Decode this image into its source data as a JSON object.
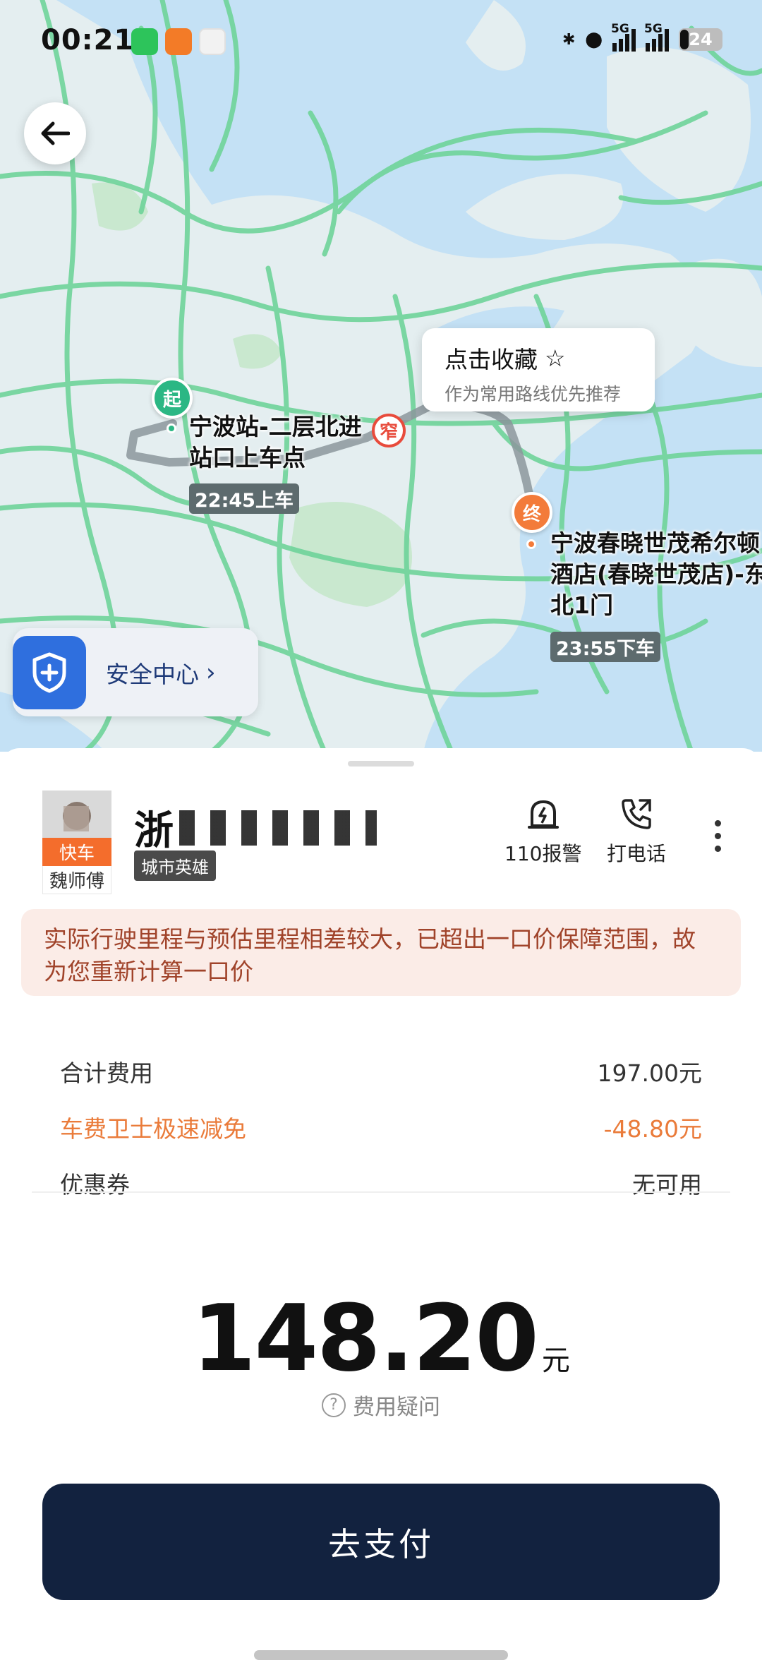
{
  "status_bar": {
    "time": "00:21",
    "battery": "24",
    "network1": "5G",
    "network2": "5G"
  },
  "map": {
    "favorite_card": {
      "title": "点击收藏",
      "subtitle": "作为常用路线优先推荐"
    },
    "start": {
      "pin": "起",
      "label_line1": "宁波站-二层北进",
      "label_line2": "站口上车点",
      "time": "22:45上车"
    },
    "end": {
      "pin": "终",
      "label_line1": "宁波春晓世茂希尔顿",
      "label_line2": "酒店(春晓世茂店)-东",
      "label_line3": "北1门",
      "time": "23:55下车"
    },
    "narrow_badge": "窄",
    "safety_center": "安全中心",
    "colors": {
      "road": "#6fd49a",
      "water": "#c4e1f5",
      "route": "#8c979c"
    }
  },
  "driver": {
    "tag": "快车",
    "name": "魏师傅",
    "plate_prefix": "浙",
    "plate_badge": "城市英雄"
  },
  "actions": {
    "police": "110报警",
    "call": "打电话"
  },
  "notice": "实际行驶里程与预估里程相差较大，已超出一口价保障范围，故为您重新计算一口价",
  "fees": {
    "total_label": "合计费用",
    "total_value": "197.00元",
    "discount_label": "车费卫士极速减免",
    "discount_value": "-48.80元",
    "coupon_label": "优惠券",
    "coupon_value": "无可用"
  },
  "payable": {
    "amount": "148.20",
    "unit": "元",
    "question": "费用疑问"
  },
  "pay_button": "去支付"
}
